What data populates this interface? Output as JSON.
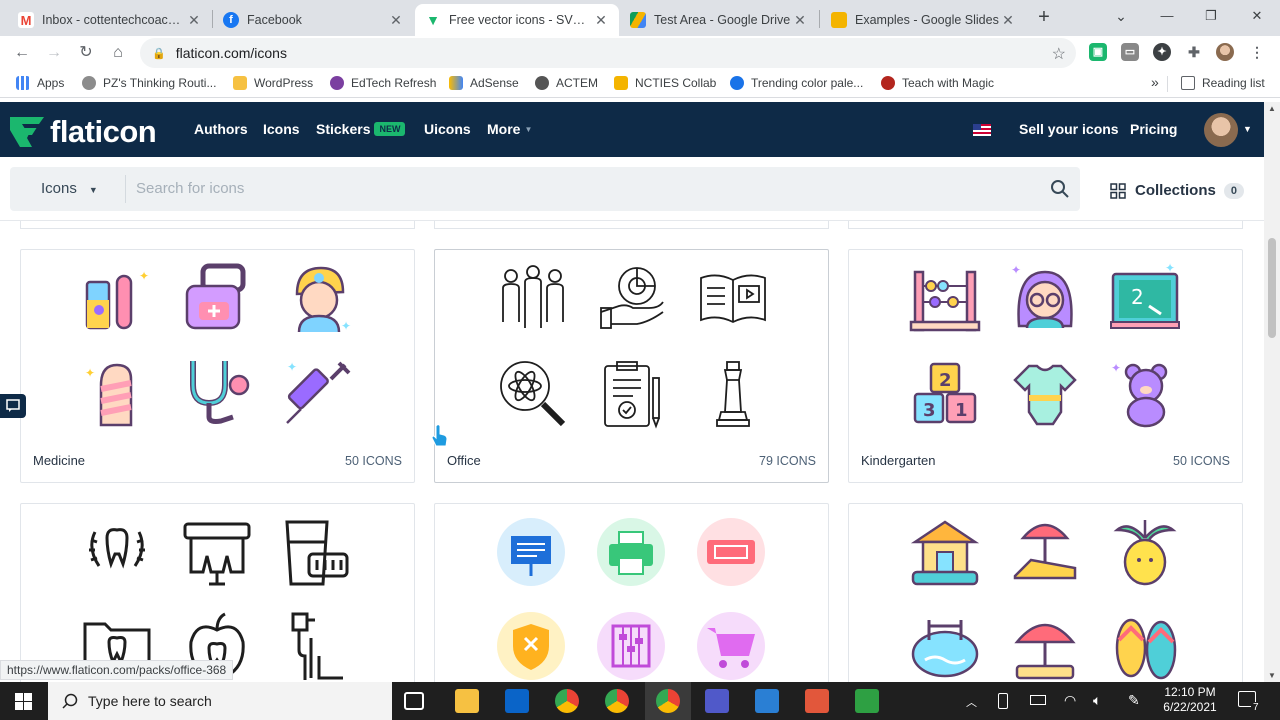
{
  "browser": {
    "tabs": [
      {
        "title": "Inbox - cottentechcoach@",
        "favicon": "gmail-icon",
        "color": "#ea4335"
      },
      {
        "title": "Facebook",
        "favicon": "facebook-icon",
        "color": "#1877f2"
      },
      {
        "title": "Free vector icons - SVG, P",
        "favicon": "flaticon-icon",
        "color": "#1bb76e",
        "active": true
      },
      {
        "title": "Test Area - Google Drive",
        "favicon": "drive-icon",
        "color": "#0f9d58"
      },
      {
        "title": "Examples - Google Slides",
        "favicon": "slides-icon",
        "color": "#f4b400"
      }
    ],
    "url": "flaticon.com/icons",
    "bookmarks": [
      {
        "label": "Apps",
        "color": "#4285f4"
      },
      {
        "label": "PZ's Thinking Routi...",
        "color": "#8c8c8c"
      },
      {
        "label": "WordPress",
        "color": "#f6c142"
      },
      {
        "label": "EdTech Refresh",
        "color": "#7b3fa0"
      },
      {
        "label": "AdSense",
        "color": "#fbbc04"
      },
      {
        "label": "ACTEM",
        "color": "#555555"
      },
      {
        "label": "NCTIES Collab",
        "color": "#f4b400"
      },
      {
        "label": "Trending color pale...",
        "color": "#1a73e8"
      },
      {
        "label": "Teach with Magic",
        "color": "#b3261e"
      }
    ],
    "more_bookmarks": "»",
    "reading_list": "Reading list",
    "status_url": "https://www.flaticon.com/packs/office-368"
  },
  "flaticon": {
    "logo_text": "flaticon",
    "nav": {
      "authors": "Authors",
      "icons": "Icons",
      "stickers": "Stickers",
      "new_badge": "NEW",
      "uicons": "Uicons",
      "more": "More"
    },
    "sell": "Sell your icons",
    "pricing": "Pricing",
    "search": {
      "type": "Icons",
      "placeholder": "Search for icons"
    },
    "collections_label": "Collections",
    "collections_count": "0",
    "packs": [
      {
        "name": "Medicine",
        "count": "50 ICONS"
      },
      {
        "name": "Office",
        "count": "79 ICONS"
      },
      {
        "name": "Kindergarten",
        "count": "50 ICONS"
      }
    ]
  },
  "taskbar": {
    "search_placeholder": "Type here to search",
    "time": "12:10 PM",
    "date": "6/22/2021",
    "notifications": "7"
  },
  "colors": {
    "flaticon_navy": "#0e2a47",
    "flaticon_green": "#1bb76e"
  }
}
